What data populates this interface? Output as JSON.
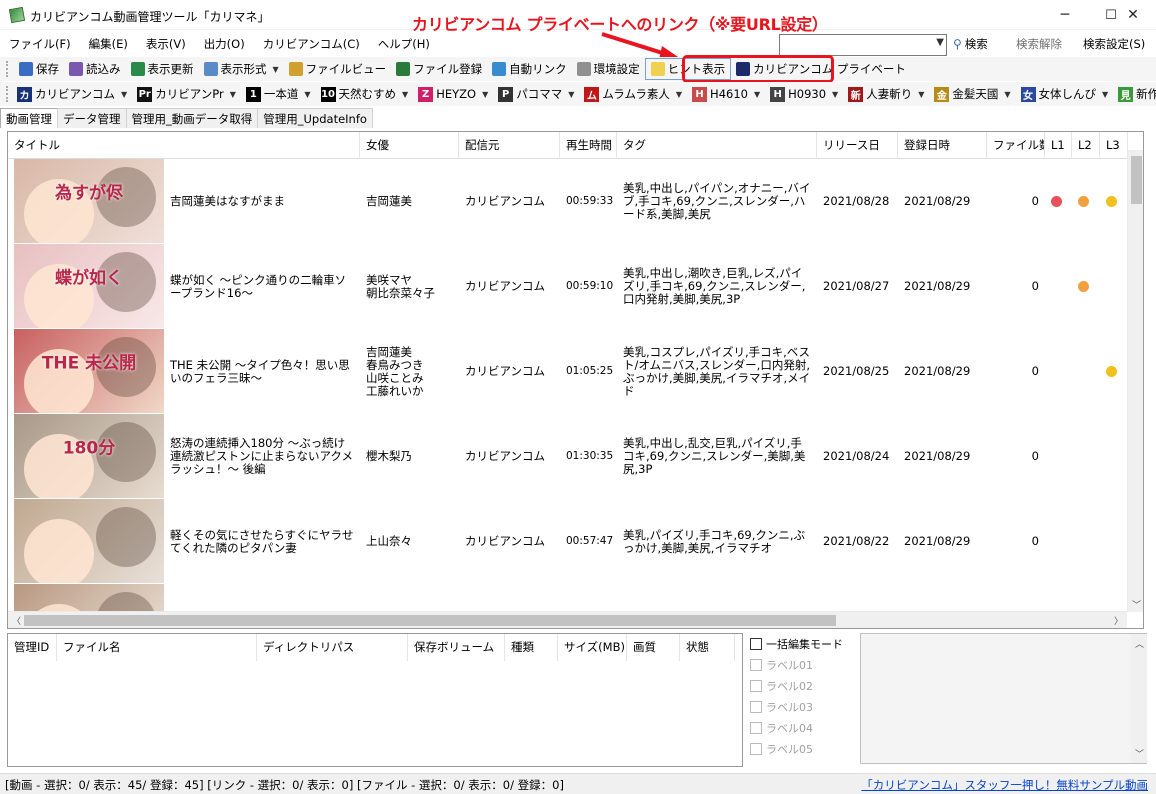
{
  "window": {
    "title": "カリビアンコム動画管理ツール「カリマネ」",
    "min_glyph": "─",
    "max_glyph": "☐",
    "close_glyph": "✕"
  },
  "annotation": {
    "text": "カリビアンコム プライベートへのリンク（※要URL設定）",
    "color": "#e8141e"
  },
  "menu": [
    "ファイル(F)",
    "編集(E)",
    "表示(V)",
    "出力(O)",
    "カリビアンコム(C)",
    "ヘルプ(H)"
  ],
  "search": {
    "value": "",
    "search_label": "検索",
    "clear_label": "検索解除",
    "settings_label": "検索設定(S)"
  },
  "toolbar1": [
    {
      "label": "保存",
      "icon": "save-icon",
      "color": "#3a6cc4"
    },
    {
      "label": "読込み",
      "icon": "load-icon",
      "color": "#7a58b0"
    },
    {
      "label": "表示更新",
      "icon": "refresh-icon",
      "color": "#2a8a4a"
    },
    {
      "label": "表示形式",
      "icon": "view-format-icon",
      "color": "#5a8ac8"
    },
    {
      "label": "ファイルビュー",
      "icon": "file-view-icon",
      "color": "#d0a030"
    },
    {
      "label": "ファイル登録",
      "icon": "file-register-icon",
      "color": "#2a7a3a"
    },
    {
      "label": "自動リンク",
      "icon": "auto-link-icon",
      "color": "#3a8ad0"
    },
    {
      "label": "環境設定",
      "icon": "gear-icon",
      "color": "#909090"
    },
    {
      "label": "ヒント表示",
      "icon": "hint-icon",
      "color": "#f0d050"
    },
    {
      "label": "カリビアンコム プライベート",
      "icon": "carib-private-icon",
      "color": "#1a2a6a"
    }
  ],
  "toolbar2": [
    {
      "label": "カリビアンコム",
      "icon_text": "カ",
      "color": "#18327a"
    },
    {
      "label": "カリビアンPr",
      "icon_text": "Pr",
      "color": "#111111"
    },
    {
      "label": "一本道",
      "icon_text": "1",
      "color": "#000000"
    },
    {
      "label": "天然むすめ",
      "icon_text": "10",
      "color": "#000000"
    },
    {
      "label": "HEYZO",
      "icon_text": "Z",
      "color": "#d0206a"
    },
    {
      "label": "パコママ",
      "icon_text": "P",
      "color": "#333333"
    },
    {
      "label": "ムラムラ素人",
      "icon_text": "ム",
      "color": "#c01818"
    },
    {
      "label": "H4610",
      "icon_text": "H",
      "color": "#c84a4a"
    },
    {
      "label": "H0930",
      "icon_text": "H",
      "color": "#444444"
    },
    {
      "label": "人妻斬り",
      "icon_text": "新",
      "color": "#a01818"
    },
    {
      "label": "金髪天國",
      "icon_text": "金",
      "color": "#b88a18"
    },
    {
      "label": "女体しんぴ",
      "icon_text": "女",
      "color": "#2a4aa0"
    },
    {
      "label": "新作見放題",
      "icon_text": "見",
      "color": "#3a9a3a"
    }
  ],
  "tabs": [
    "動画管理",
    "データ管理",
    "管理用_動画データ取得",
    "管理用_UpdateInfo"
  ],
  "grid": {
    "columns": [
      "タイトル",
      "女優",
      "配信元",
      "再生時間",
      "タグ",
      "リリース日",
      "登録日時",
      "ファイル数",
      "L1",
      "L2",
      "L3"
    ],
    "rows": [
      {
        "thumb_label": "為すが侭",
        "thumb_bg": [
          "#d8b8a8",
          "#f0e0d8"
        ],
        "title": "吉岡蓮美はなすがまま",
        "actress": "吉岡蓮美",
        "source": "カリビアンコム",
        "duration": "00:59:33",
        "tags": "美乳,中出し,パイパン,オナニー,バイブ,手コキ,69,クンニ,スレンダー,ハード系,美脚,美尻",
        "release": "2021/08/28",
        "registered": "2021/08/29",
        "files": "0",
        "l1": "#e8505a",
        "l2": "#f0a040",
        "l3": "#f0c020"
      },
      {
        "thumb_label": "蝶が如く",
        "thumb_bg": [
          "#e8c0c0",
          "#f8e8e8"
        ],
        "title": "蝶が如く ～ピンク通りの二輪車ソープランド16～",
        "actress": "美咲マヤ\n朝比奈菜々子",
        "source": "カリビアンコム",
        "duration": "00:59:10",
        "tags": "美乳,中出し,潮吹き,巨乳,レズ,パイズリ,手コキ,69,クンニ,スレンダー,口内発射,美脚,美尻,3P",
        "release": "2021/08/27",
        "registered": "2021/08/29",
        "files": "0",
        "l1": "",
        "l2": "#f0a040",
        "l3": ""
      },
      {
        "thumb_label": "THE 未公開",
        "thumb_bg": [
          "#c86060",
          "#f0d8c8"
        ],
        "title": "THE 未公開 ～タイプ色々！思い思いのフェラ三昧～",
        "actress": "吉岡蓮美\n春鳥みつき\n山咲ことみ\n工藤れいか",
        "source": "カリビアンコム",
        "duration": "01:05:25",
        "tags": "美乳,コスプレ,パイズリ,手コキ,ベスト/オムニバス,スレンダー,口内発射,ぶっかけ,美脚,美尻,イラマチオ,メイド",
        "release": "2021/08/25",
        "registered": "2021/08/29",
        "files": "0",
        "l1": "",
        "l2": "",
        "l3": "#f0c020"
      },
      {
        "thumb_label": "180分",
        "thumb_bg": [
          "#a89888",
          "#e8dcd0"
        ],
        "title": "怒涛の連続挿入180分 ～ぶっ続け連続激ピストンに止まらないアクメラッシュ！～ 後編",
        "actress": "櫻木梨乃",
        "source": "カリビアンコム",
        "duration": "01:30:35",
        "tags": "美乳,中出し,乱交,巨乳,パイズリ,手コキ,69,クンニ,スレンダー,美脚,美尻,3P",
        "release": "2021/08/24",
        "registered": "2021/08/29",
        "files": "0",
        "l1": "",
        "l2": "",
        "l3": ""
      },
      {
        "thumb_label": "",
        "thumb_bg": [
          "#c0a890",
          "#e8e0d8"
        ],
        "title": "軽くその気にさせたらすぐにヤラせてくれた隣のピタパン妻",
        "actress": "上山奈々",
        "source": "カリビアンコム",
        "duration": "00:57:47",
        "tags": "美乳,パイズリ,手コキ,69,クンニ,ぶっかけ,美脚,美尻,イラマチオ",
        "release": "2021/08/22",
        "registered": "2021/08/29",
        "files": "0",
        "l1": "",
        "l2": "",
        "l3": ""
      },
      {
        "thumb_label": "",
        "thumb_bg": [
          "#b89880",
          "#f0e8e0"
        ],
        "title": "",
        "actress": "",
        "source": "",
        "duration": "",
        "tags": "",
        "release": "",
        "registered": "",
        "files": "",
        "l1": "",
        "l2": "",
        "l3": ""
      }
    ]
  },
  "file_grid": {
    "columns": [
      "管理ID",
      "ファイル名",
      "ディレクトリパス",
      "保存ボリューム",
      "種類",
      "サイズ(MB)",
      "画質",
      "状態"
    ]
  },
  "labels": {
    "bulk_edit": "一括編集モード",
    "items": [
      "ラベル01",
      "ラベル02",
      "ラベル03",
      "ラベル04",
      "ラベル05"
    ]
  },
  "status": {
    "text": "[動画 - 選択：0/ 表示：45/ 登録：45] [リンク - 選択：0/ 表示：0] [ファイル - 選択：0/ 表示：0/ 登録：0]",
    "link": "「カリビアンコム」スタッフ一押し！無料サンプル動画"
  }
}
